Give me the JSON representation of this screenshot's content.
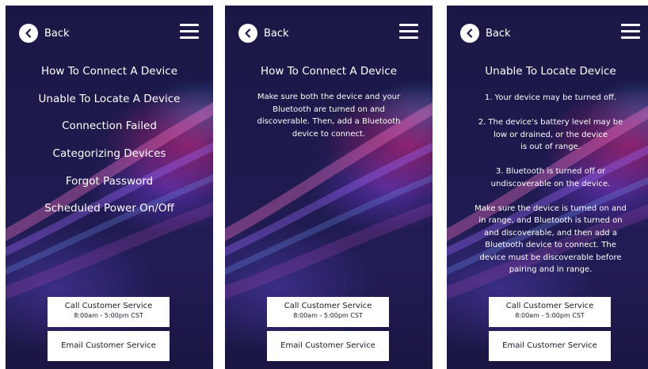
{
  "common": {
    "back_label": "Back",
    "call_label": "Call Customer Service",
    "call_hours": "8:00am - 5:00pm CST",
    "email_label": "Email Customer Service"
  },
  "screen1": {
    "menu": [
      "How To Connect A Device",
      "Unable To Locate A Device",
      "Connection Failed",
      "Categorizing Devices",
      "Forgot Password",
      "Scheduled Power On/Off"
    ]
  },
  "screen2": {
    "title": "How To Connect A Device",
    "body": "Make sure both the device and your\nBluetooth are turned on and\ndiscoverable. Then, add a Bluetooth\ndevice to connect."
  },
  "screen3": {
    "title": "Unable To Locate Device",
    "paragraphs": [
      "1. Your device may be turned off.",
      "2. The device's battery level may be\nlow or drained, or the device\nis out of range.",
      "3. Bluetooth is turned off or\nundiscoverable on the device.",
      "Make sure the device is turned on and\nin range, and Bluetooth is turned on\nand discoverable, and then add a\nBluetooth device to connect. The\ndevice must be discoverable before\npairing and in range."
    ]
  },
  "colors": {
    "background": "#1e1a4e",
    "accent_pink": "#e6288c",
    "accent_purple": "#783cdc",
    "button_bg": "#ffffff"
  },
  "icons": {
    "back": "chevron-left-icon",
    "menu": "hamburger-menu-icon"
  }
}
